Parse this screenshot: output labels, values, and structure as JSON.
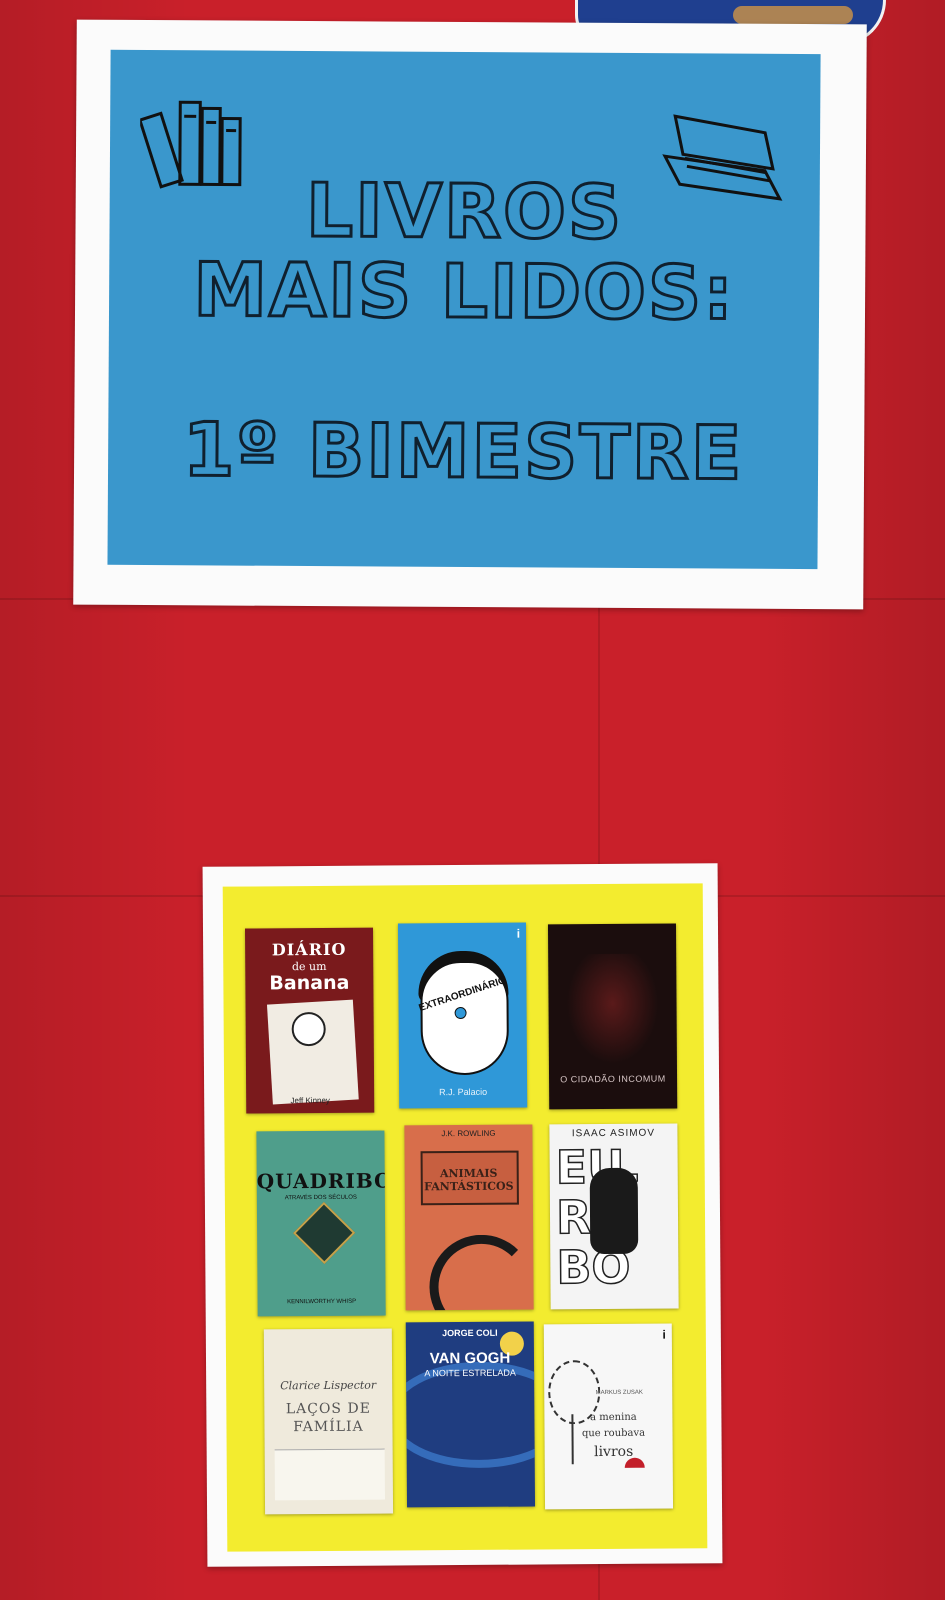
{
  "sign_top": {
    "line1": "LIVROS",
    "line2": "MAIS LIDOS:",
    "line3": "1º BIMESTRE",
    "icons": [
      "books-stack-icon",
      "books-pile-icon"
    ]
  },
  "books": [
    {
      "title_a": "DIÁRIO",
      "title_b": "de um",
      "title_c": "Banana",
      "author": "Jeff Kinney"
    },
    {
      "title": "EXTRAORDINÁRIO",
      "author": "R.J. Palacio",
      "badge": "i"
    },
    {
      "title": "O CIDADÃO INCOMUM"
    },
    {
      "title": "QUADRIBOL",
      "subtitle": "ATRAVÉS DOS SÉCULOS",
      "author": "KENNILWORTHY WHISP"
    },
    {
      "author": "J.K. ROWLING",
      "title": "ANIMAIS FANTÁSTICOS"
    },
    {
      "author": "ISAAC ASIMOV",
      "title_a": "EU,",
      "title_b": "RO",
      "title_c": "BÔ"
    },
    {
      "author": "Clarice Lispector",
      "title_a": "LAÇOS DE",
      "title_b": "FAMÍLIA"
    },
    {
      "author": "JORGE COLI",
      "title": "VAN GOGH",
      "subtitle": "A NOITE ESTRELADA"
    },
    {
      "author": "MARKUS ZUSAK",
      "title_a": "a menina",
      "title_b": "que roubava",
      "title_c": "livros",
      "badge": "i"
    }
  ]
}
